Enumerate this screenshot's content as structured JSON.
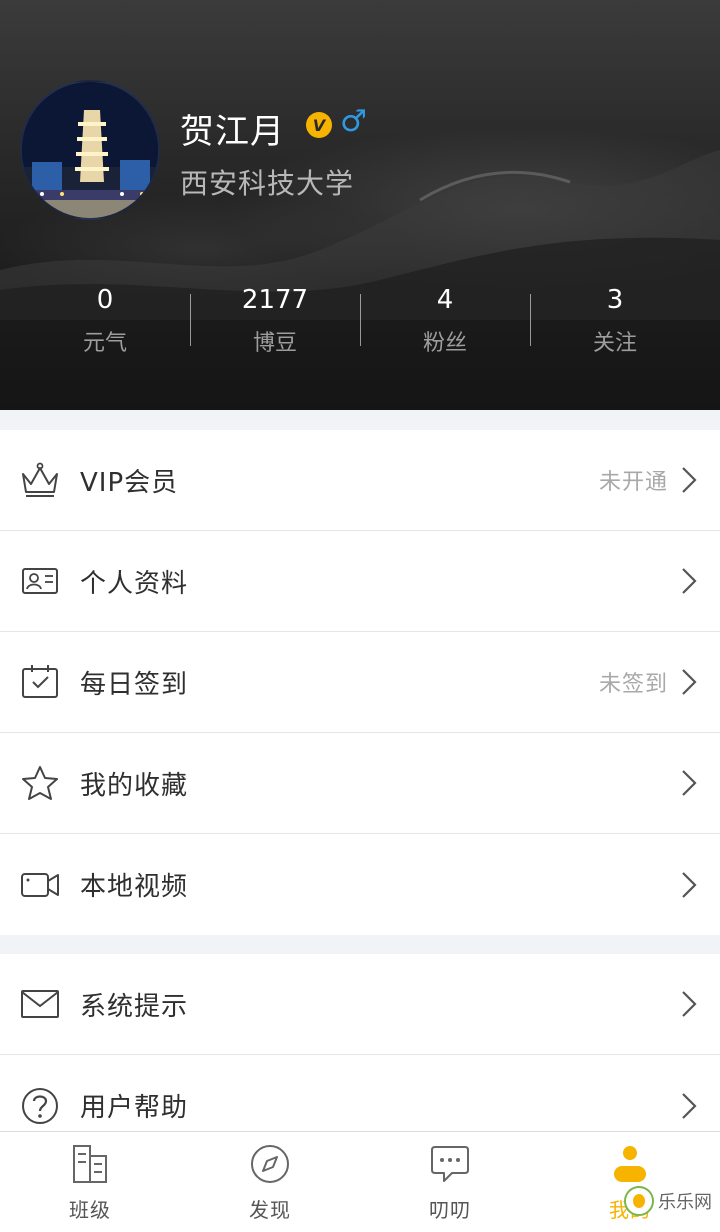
{
  "profile": {
    "name": "贺江月",
    "vip_badge": "V",
    "gender_symbol": "♂",
    "school": "西安科技大学"
  },
  "stats": [
    {
      "value": "0",
      "label": "元气"
    },
    {
      "value": "2177",
      "label": "博豆"
    },
    {
      "value": "4",
      "label": "粉丝"
    },
    {
      "value": "3",
      "label": "关注"
    }
  ],
  "menu": {
    "vip": {
      "label": "VIP会员",
      "status": "未开通",
      "icon": "crown-icon"
    },
    "profile": {
      "label": "个人资料",
      "icon": "id-card-icon"
    },
    "checkin": {
      "label": "每日签到",
      "status": "未签到",
      "icon": "calendar-check-icon"
    },
    "favorites": {
      "label": "我的收藏",
      "icon": "star-icon"
    },
    "local_video": {
      "label": "本地视频",
      "icon": "video-icon"
    },
    "system_notice": {
      "label": "系统提示",
      "icon": "envelope-icon"
    },
    "help": {
      "label": "用户帮助",
      "icon": "question-icon"
    }
  },
  "tabbar": {
    "items": [
      {
        "label": "班级",
        "icon": "building-icon"
      },
      {
        "label": "发现",
        "icon": "compass-icon"
      },
      {
        "label": "叨叨",
        "icon": "chat-bubble-icon"
      },
      {
        "label": "我的",
        "icon": "user-icon",
        "active": true
      }
    ]
  },
  "watermark": {
    "text": "乐乐网"
  },
  "colors": {
    "accent": "#f6b400",
    "gender_blue": "#2f9ae0",
    "background": "#f1f3f6"
  }
}
